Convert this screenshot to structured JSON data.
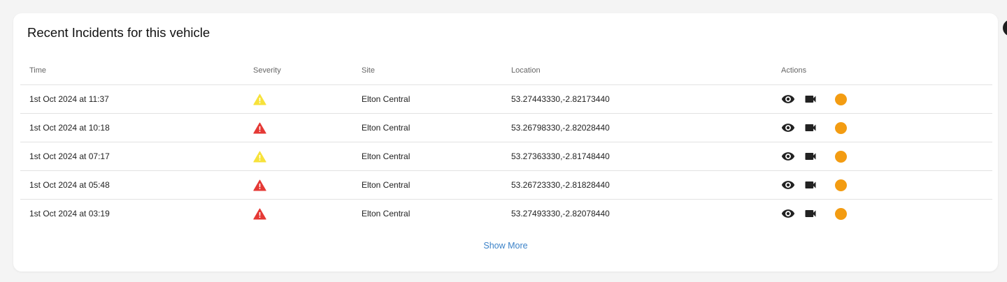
{
  "title": "Recent Incidents for this vehicle",
  "columns": {
    "time": "Time",
    "severity": "Severity",
    "site": "Site",
    "location": "Location",
    "actions": "Actions"
  },
  "rows": [
    {
      "time": "1st Oct 2024 at 11:37",
      "severity": "warning",
      "site": "Elton Central",
      "location": "53.27443330,-2.82173440"
    },
    {
      "time": "1st Oct 2024 at 10:18",
      "severity": "critical",
      "site": "Elton Central",
      "location": "53.26798330,-2.82028440"
    },
    {
      "time": "1st Oct 2024 at 07:17",
      "severity": "warning",
      "site": "Elton Central",
      "location": "53.27363330,-2.81748440"
    },
    {
      "time": "1st Oct 2024 at 05:48",
      "severity": "critical",
      "site": "Elton Central",
      "location": "53.26723330,-2.81828440"
    },
    {
      "time": "1st Oct 2024 at 03:19",
      "severity": "critical",
      "site": "Elton Central",
      "location": "53.27493330,-2.82078440"
    }
  ],
  "show_more": "Show More",
  "icons": {
    "view": "eye-icon",
    "video": "video-camera-icon",
    "status": "status-dot",
    "warning": "warning-triangle-icon",
    "critical": "alert-triangle-icon"
  },
  "colors": {
    "warning": "#f7e23a",
    "critical": "#e53935",
    "status_dot": "#f39c12",
    "link": "#3b82c8"
  }
}
